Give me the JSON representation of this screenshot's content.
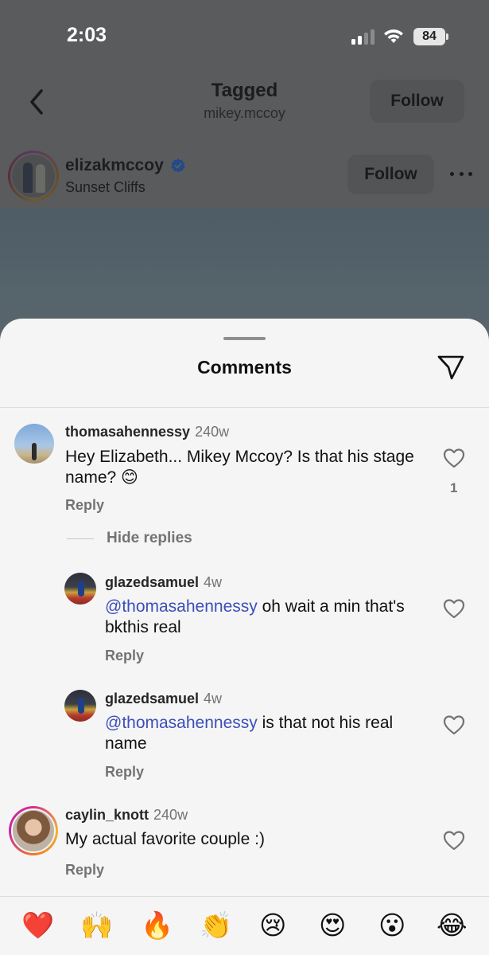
{
  "status_bar": {
    "time": "2:03",
    "battery": "84"
  },
  "nav": {
    "title": "Tagged",
    "subtitle": "mikey.mccoy",
    "follow_label": "Follow"
  },
  "post": {
    "username": "elizakmccoy",
    "location": "Sunset Cliffs",
    "follow_label": "Follow"
  },
  "sheet": {
    "title": "Comments"
  },
  "comments": [
    {
      "username": "thomasahennessy",
      "ago": "240w",
      "text": "Hey Elizabeth... Mikey Mccoy? Is that his stage name? 😊",
      "reply_label": "Reply",
      "likes": "1",
      "hide_replies_label": "Hide replies"
    },
    {
      "username": "glazedsamuel",
      "ago": "4w",
      "mention": "@thomasahennessy",
      "text": "oh wait a min that's bkthis real",
      "reply_label": "Reply"
    },
    {
      "username": "glazedsamuel",
      "ago": "4w",
      "mention": "@thomasahennessy",
      "text": "is that not his real name",
      "reply_label": "Reply"
    },
    {
      "username": "caylin_knott",
      "ago": "240w",
      "text": "My actual favorite couple :)",
      "reply_label": "Reply"
    }
  ],
  "emoji_bar": [
    "❤️",
    "🙌",
    "🔥",
    "👏",
    "😢",
    "😍",
    "😮",
    "😂"
  ],
  "colors": {
    "mention": "#3b4fb8",
    "sheet_bg": "#f5f5f5",
    "overlay": "#595b5c"
  }
}
